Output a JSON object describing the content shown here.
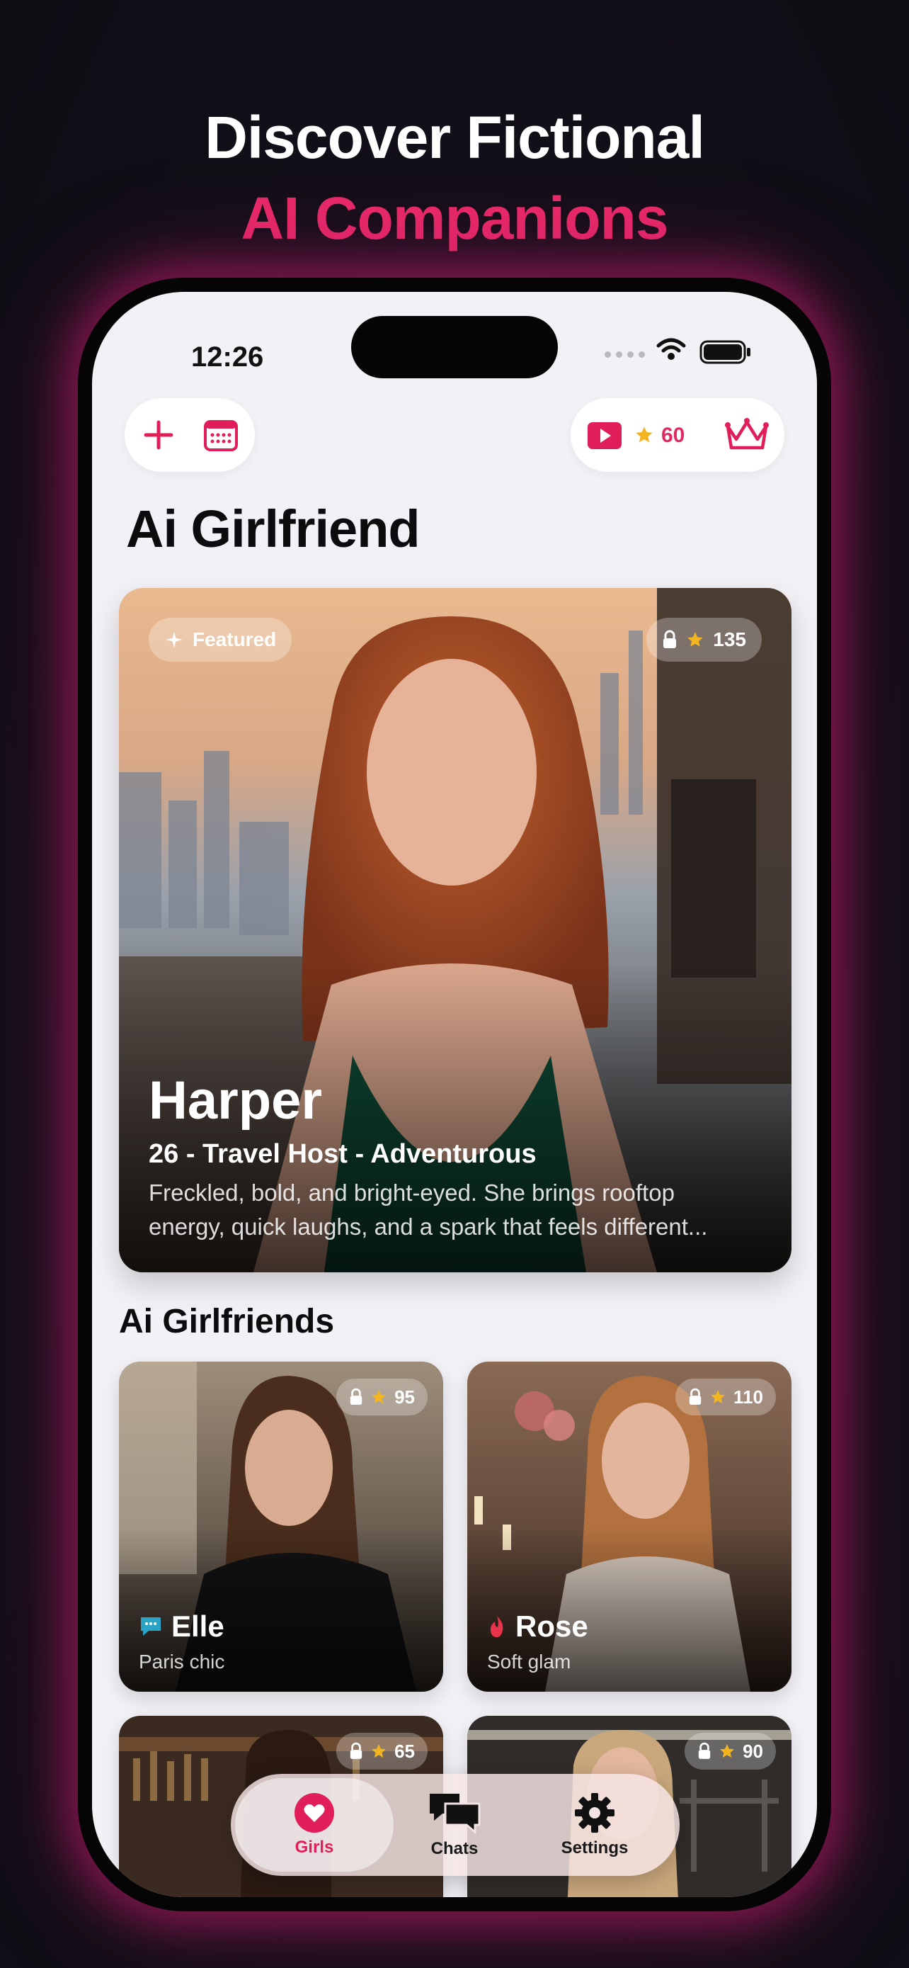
{
  "headline": {
    "line1": "Discover Fictional",
    "line2": "AI Companions"
  },
  "status_bar": {
    "time": "12:26"
  },
  "toolbar": {
    "coins": "60",
    "icons": [
      "plus-icon",
      "calendar-icon",
      "video-ad-icon",
      "star-icon",
      "crown-icon"
    ]
  },
  "page": {
    "title": "Ai Girlfriend"
  },
  "featured": {
    "badge": "Featured",
    "price": "135",
    "name": "Harper",
    "meta": "26 - Travel Host - Adventurous",
    "description_line1": "Freckled, bold, and bright-eyed. She brings rooftop",
    "description_line2": "energy, quick laughs, and a spark that feels different..."
  },
  "section": {
    "title": "Ai Girlfriends"
  },
  "cards": [
    {
      "name": "Elle",
      "subtitle": "Paris chic",
      "price": "95",
      "icon": "chat-bubble-icon"
    },
    {
      "name": "Rose",
      "subtitle": "Soft glam",
      "price": "110",
      "icon": "flame-icon"
    },
    {
      "name": "",
      "subtitle": "",
      "price": "65",
      "icon": ""
    },
    {
      "name": "",
      "subtitle": "",
      "price": "90",
      "icon": ""
    }
  ],
  "tabs": [
    {
      "label": "Girls",
      "icon": "heart-icon",
      "active": true
    },
    {
      "label": "Chats",
      "icon": "chats-icon",
      "active": false
    },
    {
      "label": "Settings",
      "icon": "gear-icon",
      "active": false
    }
  ],
  "colors": {
    "accent": "#e01e5a",
    "headline_pink": "#ea2a6a",
    "background": "#0e0d14",
    "screen": "#f2f1f6"
  }
}
